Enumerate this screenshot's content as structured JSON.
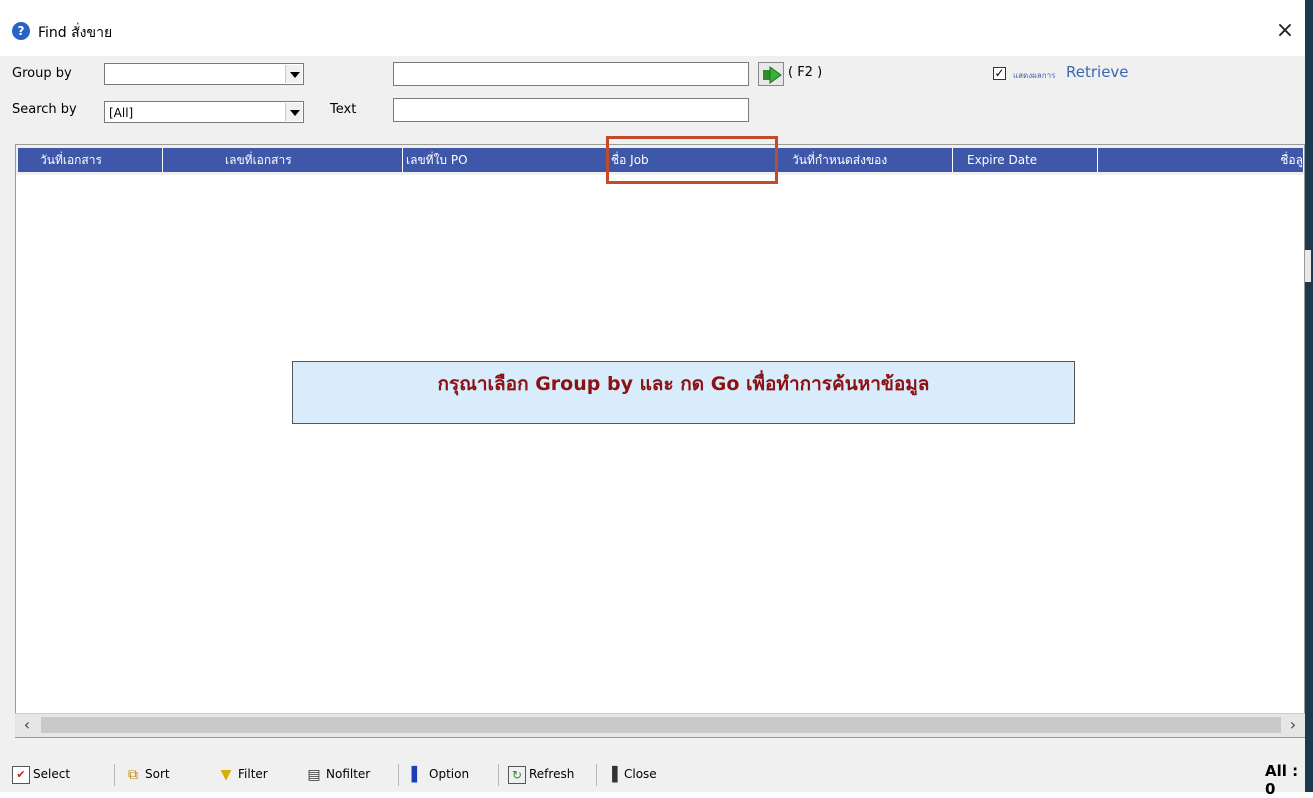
{
  "window": {
    "title": "Find สั่งขาย",
    "help_icon": "help-icon",
    "close_glyph": "×"
  },
  "filters": {
    "group_by_label": "Group by",
    "group_by_value": "",
    "search_by_label": "Search by",
    "search_by_value": "[All]",
    "text_label": "Text",
    "group_by_text_value": "",
    "search_text_value": "",
    "go_shortcut": "( F2 )",
    "retrieve_checked": true,
    "retrieve_small_label": "แสดงผลการ",
    "retrieve_label": "Retrieve"
  },
  "grid": {
    "columns": [
      {
        "label": "วันที่เอกสาร"
      },
      {
        "label": "เลขที่เอกสาร"
      },
      {
        "label": "เลขที่ใบ PO"
      },
      {
        "label": "ชื่อ Job"
      },
      {
        "label": "วันที่กำหนดส่งของ"
      },
      {
        "label": "Expire Date"
      },
      {
        "label": "ชื่อลู"
      }
    ],
    "message": "กรุณาเลือก Group  by และ กด Go เพื่อทำการค้นหาข้อมูล"
  },
  "scroll": {
    "left": "‹",
    "right": "›"
  },
  "toolbar": {
    "select": "Select",
    "sort": "Sort",
    "filter": "Filter",
    "nofilter": "Nofilter",
    "option": "Option",
    "refresh": "Refresh",
    "close": "Close"
  },
  "status": {
    "all_count": "All : 0"
  },
  "colors": {
    "header_bg": "#3f57a8",
    "message_bg": "#d8ecfc",
    "message_text": "#8a1212",
    "highlight": "#c44a2c",
    "retrieve_text": "#3a66b0"
  }
}
